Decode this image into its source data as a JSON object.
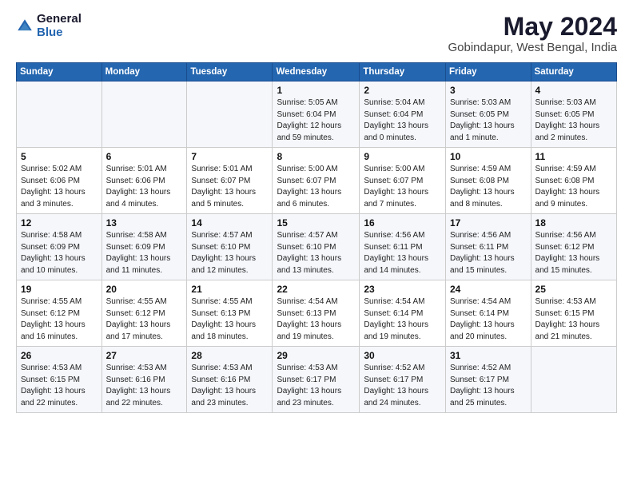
{
  "logo": {
    "general": "General",
    "blue": "Blue"
  },
  "title": {
    "month": "May 2024",
    "location": "Gobindapur, West Bengal, India"
  },
  "weekdays": [
    "Sunday",
    "Monday",
    "Tuesday",
    "Wednesday",
    "Thursday",
    "Friday",
    "Saturday"
  ],
  "weeks": [
    [
      {
        "day": "",
        "sunrise": "",
        "sunset": "",
        "daylight": ""
      },
      {
        "day": "",
        "sunrise": "",
        "sunset": "",
        "daylight": ""
      },
      {
        "day": "",
        "sunrise": "",
        "sunset": "",
        "daylight": ""
      },
      {
        "day": "1",
        "sunrise": "Sunrise: 5:05 AM",
        "sunset": "Sunset: 6:04 PM",
        "daylight": "Daylight: 12 hours and 59 minutes."
      },
      {
        "day": "2",
        "sunrise": "Sunrise: 5:04 AM",
        "sunset": "Sunset: 6:04 PM",
        "daylight": "Daylight: 13 hours and 0 minutes."
      },
      {
        "day": "3",
        "sunrise": "Sunrise: 5:03 AM",
        "sunset": "Sunset: 6:05 PM",
        "daylight": "Daylight: 13 hours and 1 minute."
      },
      {
        "day": "4",
        "sunrise": "Sunrise: 5:03 AM",
        "sunset": "Sunset: 6:05 PM",
        "daylight": "Daylight: 13 hours and 2 minutes."
      }
    ],
    [
      {
        "day": "5",
        "sunrise": "Sunrise: 5:02 AM",
        "sunset": "Sunset: 6:06 PM",
        "daylight": "Daylight: 13 hours and 3 minutes."
      },
      {
        "day": "6",
        "sunrise": "Sunrise: 5:01 AM",
        "sunset": "Sunset: 6:06 PM",
        "daylight": "Daylight: 13 hours and 4 minutes."
      },
      {
        "day": "7",
        "sunrise": "Sunrise: 5:01 AM",
        "sunset": "Sunset: 6:07 PM",
        "daylight": "Daylight: 13 hours and 5 minutes."
      },
      {
        "day": "8",
        "sunrise": "Sunrise: 5:00 AM",
        "sunset": "Sunset: 6:07 PM",
        "daylight": "Daylight: 13 hours and 6 minutes."
      },
      {
        "day": "9",
        "sunrise": "Sunrise: 5:00 AM",
        "sunset": "Sunset: 6:07 PM",
        "daylight": "Daylight: 13 hours and 7 minutes."
      },
      {
        "day": "10",
        "sunrise": "Sunrise: 4:59 AM",
        "sunset": "Sunset: 6:08 PM",
        "daylight": "Daylight: 13 hours and 8 minutes."
      },
      {
        "day": "11",
        "sunrise": "Sunrise: 4:59 AM",
        "sunset": "Sunset: 6:08 PM",
        "daylight": "Daylight: 13 hours and 9 minutes."
      }
    ],
    [
      {
        "day": "12",
        "sunrise": "Sunrise: 4:58 AM",
        "sunset": "Sunset: 6:09 PM",
        "daylight": "Daylight: 13 hours and 10 minutes."
      },
      {
        "day": "13",
        "sunrise": "Sunrise: 4:58 AM",
        "sunset": "Sunset: 6:09 PM",
        "daylight": "Daylight: 13 hours and 11 minutes."
      },
      {
        "day": "14",
        "sunrise": "Sunrise: 4:57 AM",
        "sunset": "Sunset: 6:10 PM",
        "daylight": "Daylight: 13 hours and 12 minutes."
      },
      {
        "day": "15",
        "sunrise": "Sunrise: 4:57 AM",
        "sunset": "Sunset: 6:10 PM",
        "daylight": "Daylight: 13 hours and 13 minutes."
      },
      {
        "day": "16",
        "sunrise": "Sunrise: 4:56 AM",
        "sunset": "Sunset: 6:11 PM",
        "daylight": "Daylight: 13 hours and 14 minutes."
      },
      {
        "day": "17",
        "sunrise": "Sunrise: 4:56 AM",
        "sunset": "Sunset: 6:11 PM",
        "daylight": "Daylight: 13 hours and 15 minutes."
      },
      {
        "day": "18",
        "sunrise": "Sunrise: 4:56 AM",
        "sunset": "Sunset: 6:12 PM",
        "daylight": "Daylight: 13 hours and 15 minutes."
      }
    ],
    [
      {
        "day": "19",
        "sunrise": "Sunrise: 4:55 AM",
        "sunset": "Sunset: 6:12 PM",
        "daylight": "Daylight: 13 hours and 16 minutes."
      },
      {
        "day": "20",
        "sunrise": "Sunrise: 4:55 AM",
        "sunset": "Sunset: 6:12 PM",
        "daylight": "Daylight: 13 hours and 17 minutes."
      },
      {
        "day": "21",
        "sunrise": "Sunrise: 4:55 AM",
        "sunset": "Sunset: 6:13 PM",
        "daylight": "Daylight: 13 hours and 18 minutes."
      },
      {
        "day": "22",
        "sunrise": "Sunrise: 4:54 AM",
        "sunset": "Sunset: 6:13 PM",
        "daylight": "Daylight: 13 hours and 19 minutes."
      },
      {
        "day": "23",
        "sunrise": "Sunrise: 4:54 AM",
        "sunset": "Sunset: 6:14 PM",
        "daylight": "Daylight: 13 hours and 19 minutes."
      },
      {
        "day": "24",
        "sunrise": "Sunrise: 4:54 AM",
        "sunset": "Sunset: 6:14 PM",
        "daylight": "Daylight: 13 hours and 20 minutes."
      },
      {
        "day": "25",
        "sunrise": "Sunrise: 4:53 AM",
        "sunset": "Sunset: 6:15 PM",
        "daylight": "Daylight: 13 hours and 21 minutes."
      }
    ],
    [
      {
        "day": "26",
        "sunrise": "Sunrise: 4:53 AM",
        "sunset": "Sunset: 6:15 PM",
        "daylight": "Daylight: 13 hours and 22 minutes."
      },
      {
        "day": "27",
        "sunrise": "Sunrise: 4:53 AM",
        "sunset": "Sunset: 6:16 PM",
        "daylight": "Daylight: 13 hours and 22 minutes."
      },
      {
        "day": "28",
        "sunrise": "Sunrise: 4:53 AM",
        "sunset": "Sunset: 6:16 PM",
        "daylight": "Daylight: 13 hours and 23 minutes."
      },
      {
        "day": "29",
        "sunrise": "Sunrise: 4:53 AM",
        "sunset": "Sunset: 6:17 PM",
        "daylight": "Daylight: 13 hours and 23 minutes."
      },
      {
        "day": "30",
        "sunrise": "Sunrise: 4:52 AM",
        "sunset": "Sunset: 6:17 PM",
        "daylight": "Daylight: 13 hours and 24 minutes."
      },
      {
        "day": "31",
        "sunrise": "Sunrise: 4:52 AM",
        "sunset": "Sunset: 6:17 PM",
        "daylight": "Daylight: 13 hours and 25 minutes."
      },
      {
        "day": "",
        "sunrise": "",
        "sunset": "",
        "daylight": ""
      }
    ]
  ]
}
